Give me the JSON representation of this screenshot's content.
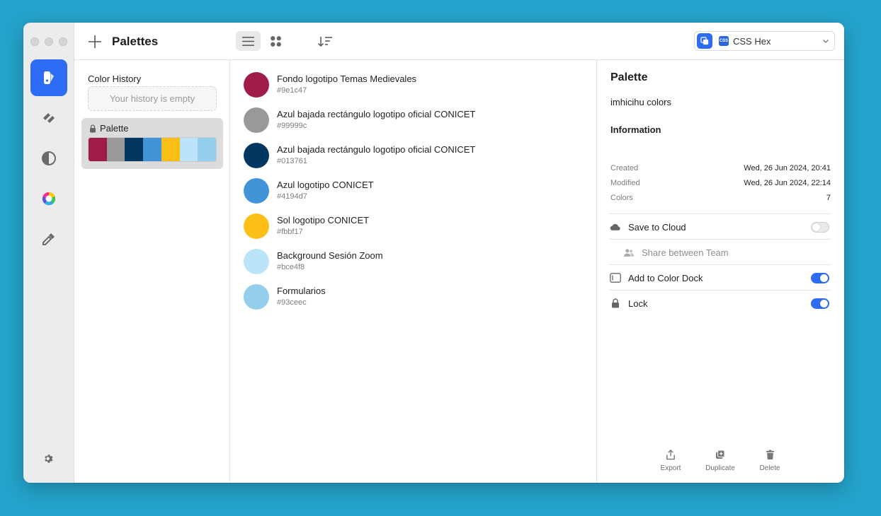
{
  "app": {
    "title": "Palettes"
  },
  "toolbar": {
    "format": {
      "label": "CSS Hex",
      "badge": "CSS"
    }
  },
  "history": {
    "title": "Color History",
    "empty_text": "Your history is empty"
  },
  "palette_card": {
    "name": "Palette",
    "swatches": [
      "#9e1c47",
      "#99999c",
      "#013761",
      "#4194d7",
      "#fbbf17",
      "#bce4f8",
      "#93ceec"
    ]
  },
  "colors": [
    {
      "name": "Fondo logotipo Temas Medievales",
      "hex": "#9e1c47"
    },
    {
      "name": "Azul bajada rectángulo logotipo oficial CONICET",
      "hex": "#99999c"
    },
    {
      "name": "Azul bajada rectángulo logotipo oficial CONICET",
      "hex": "#013761"
    },
    {
      "name": "Azul logotipo CONICET",
      "hex": "#4194d7"
    },
    {
      "name": "Sol logotipo CONICET",
      "hex": "#fbbf17"
    },
    {
      "name": "Background Sesión Zoom",
      "hex": "#bce4f8"
    },
    {
      "name": "Formularios",
      "hex": "#93ceec"
    }
  ],
  "inspector": {
    "title": "Palette",
    "palette_name": "imhicihu colors",
    "info_title": "Information",
    "created_label": "Created",
    "created_value": "Wed, 26 Jun 2024, 20:41",
    "modified_label": "Modified",
    "modified_value": "Wed, 26 Jun 2024, 22:14",
    "colors_label": "Colors",
    "colors_value": "7",
    "save_cloud_label": "Save to Cloud",
    "save_cloud_on": false,
    "share_team_label": "Share between Team",
    "color_dock_label": "Add to Color Dock",
    "color_dock_on": true,
    "lock_label": "Lock",
    "lock_on": true
  },
  "actions": {
    "export_label": "Export",
    "duplicate_label": "Duplicate",
    "delete_label": "Delete"
  },
  "accent_color": "#2f6cf6"
}
